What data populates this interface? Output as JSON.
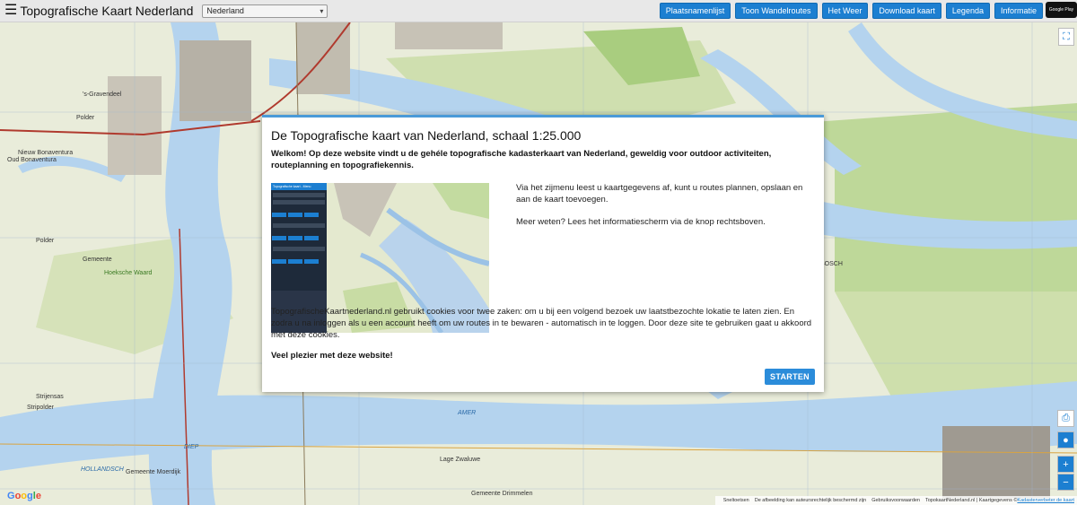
{
  "header": {
    "menu_icon": "☰",
    "title": "Topografische Kaart Nederland",
    "region_select": "Nederland",
    "buttons": [
      "Plaatsnamenlijst",
      "Toon Wandelroutes",
      "Het Weer",
      "Download kaart",
      "Legenda",
      "Informatie"
    ],
    "store_badge": "Google Play"
  },
  "map": {
    "labels": [
      "'s-Gravendeel",
      "Polder",
      "Nieuw Bonaventura",
      "Oud Bonaventura",
      "Polder",
      "Gemeente",
      "Hoeksche Waard",
      "Strijensas",
      "Stripolder",
      "HOLLANDSCH",
      "Gemeente Moerdijk",
      "DIEP",
      "AMER",
      "Lage Zwaluwe",
      "Gemeente Drimmelen",
      "BOSCH"
    ],
    "google": [
      "G",
      "o",
      "o",
      "g",
      "l",
      "e"
    ],
    "attribution": {
      "items": [
        "Sneltoetsen",
        "De afbeelding kan auteursrechtelijk beschermd zijn",
        "Gebruiksvoorwaarden",
        "TopokaartNederland.nl | Kaartgegevens ©"
      ],
      "link1": "Kadaster",
      "link2": "verbeter de kaart"
    }
  },
  "modal": {
    "title": "De Topografische kaart van Nederland, schaal 1:25.000",
    "intro": "Welkom! Op deze website vindt u de gehéle topografische kadasterkaart van Nederland, geweldig voor outdoor activiteiten, routeplanning en topografiekennis.",
    "thumb_header": "Topografische kaart - Menu",
    "right_p1": "Via het zijmenu leest u kaartgegevens af, kunt u routes plannen, opslaan en aan de kaart toevoegen.",
    "right_p2": "Meer weten? Lees het informatiescherm via de knop rechtsboven.",
    "cookie": "TopografischeKaartnederland.nl gebruikt cookies voor twee zaken: om u bij een volgend bezoek uw laatstbezochte lokatie te laten zien. En zodra u na inloggen als u een account heeft om uw routes in te bewaren - automatisch in te loggen. Door deze site te gebruiken gaat u akkoord met deze cookies.",
    "enjoy": "Veel plezier met deze website!",
    "start_button": "STARTEN"
  }
}
